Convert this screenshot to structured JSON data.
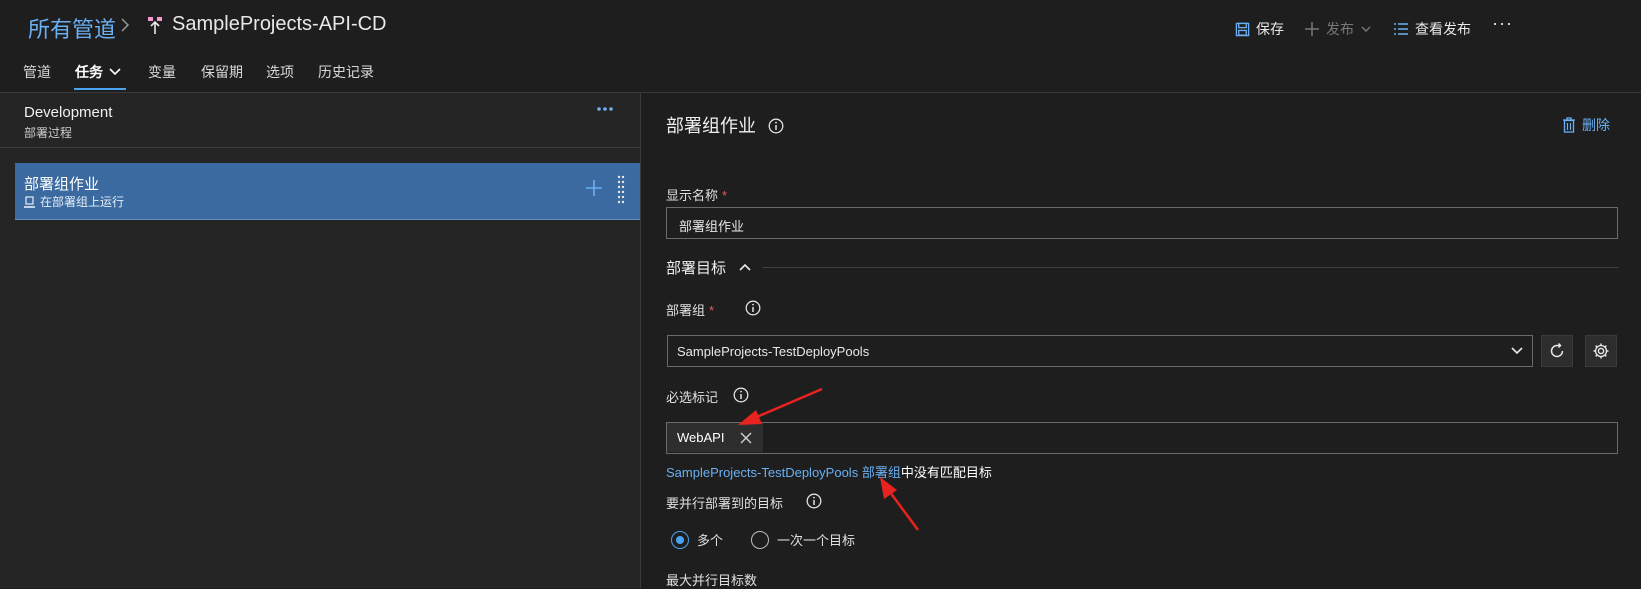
{
  "breadcrumb": {
    "root": "所有管道",
    "pipeline_name": "SampleProjects-API-CD"
  },
  "toolbar": {
    "save_label": "保存",
    "publish_label": "发布",
    "view_releases_label": "查看发布",
    "more_label": "···"
  },
  "tabs": [
    {
      "label": "管道"
    },
    {
      "label": "任务"
    },
    {
      "label": "变量"
    },
    {
      "label": "保留期"
    },
    {
      "label": "选项"
    },
    {
      "label": "历史记录"
    }
  ],
  "stage": {
    "title": "Development",
    "subtitle": "部署过程"
  },
  "job": {
    "title": "部署组作业",
    "subtitle": "在部署组上运行"
  },
  "panel": {
    "title": "部署组作业",
    "delete_label": "删除",
    "display_name_label": "显示名称",
    "display_name_value": "部署组作业",
    "section_title": "部署目标",
    "deployment_group_label": "部署组",
    "deployment_group_value": "SampleProjects-TestDeployPools",
    "required_tags_label": "必选标记",
    "tags": [
      "WebAPI"
    ],
    "warning_link1": "SampleProjects-TestDeployPools",
    "warning_link2": "部署组",
    "warning_text": "中没有匹配目标",
    "parallel_label": "要并行部署到的目标",
    "radio_multiple": "多个",
    "radio_single": "一次一个目标",
    "max_parallel_label": "最大并行目标数"
  },
  "colors": {
    "accent": "#4aa3f0",
    "link": "#6ab0f3",
    "selected_row": "#3a6aa0",
    "annotation_arrow": "#e8231f"
  }
}
